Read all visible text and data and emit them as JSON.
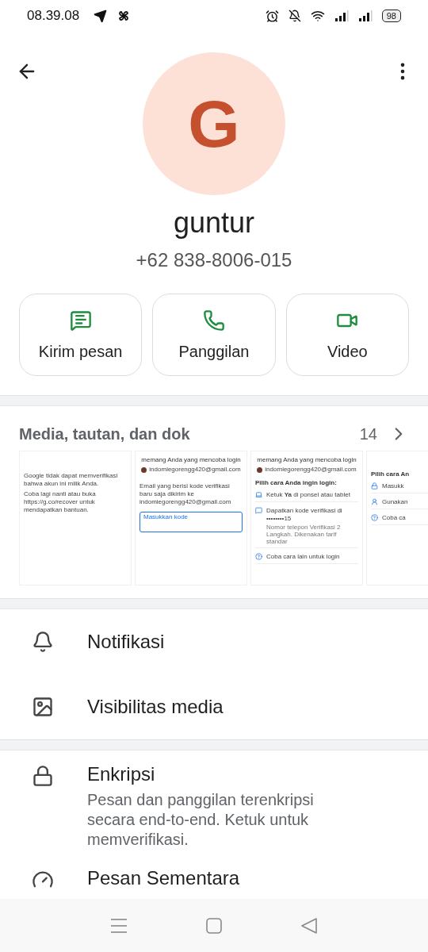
{
  "status_bar": {
    "time": "08.39.08",
    "battery": "98"
  },
  "contact": {
    "initial": "G",
    "name": "guntur",
    "phone": "+62 838-8006-015"
  },
  "actions": [
    {
      "label": "Kirim pesan",
      "kind": "message"
    },
    {
      "label": "Panggilan",
      "kind": "call"
    },
    {
      "label": "Video",
      "kind": "video"
    }
  ],
  "media": {
    "title": "Media, tautan, dan dok",
    "count": "14",
    "thumbnails": [
      {
        "kind": "notice",
        "paragraphs": [
          "Google tidak dapat memverifikasi bahwa akun ini milik Anda.",
          "Coba lagi nanti atau buka https://g.co/recover untuk mendapatkan bantuan."
        ]
      },
      {
        "kind": "code",
        "title": "memang Anda yang mencoba login",
        "email": "indomiegorengg420@gmail.com",
        "message": "Email yang berisi kode verifikasi baru saja dikirim ke indomiegorengg420@gmail.com",
        "field_label": "Masukkan kode"
      },
      {
        "kind": "options",
        "title": "memang Anda yang mencoba login",
        "email": "indomiegorengg420@gmail.com",
        "heading": "Pilih cara Anda ingin login:",
        "options": [
          {
            "label": "Ketuk **Ya** di ponsel atau tablet"
          },
          {
            "label": "Dapatkan kode verifikasi di ••••••••15",
            "note": "Nomor telepon Verifikasi 2 Langkah. Dikenakan tarif standar"
          },
          {
            "label": "Coba cara lain untuk login"
          }
        ]
      },
      {
        "kind": "options",
        "heading": "Pilih cara An",
        "options": [
          {
            "label": "Masukk"
          },
          {
            "label": "Gunakan"
          },
          {
            "label": "Coba ca"
          }
        ]
      }
    ]
  },
  "settings": [
    [
      {
        "label": "Notifikasi"
      },
      {
        "label": "Visibilitas media"
      }
    ],
    [
      {
        "label": "Enkripsi",
        "description": "Pesan dan panggilan terenkripsi secara end-to-end. Ketuk untuk memverifikasi."
      },
      {
        "label": "Pesan Sementara"
      }
    ]
  ]
}
